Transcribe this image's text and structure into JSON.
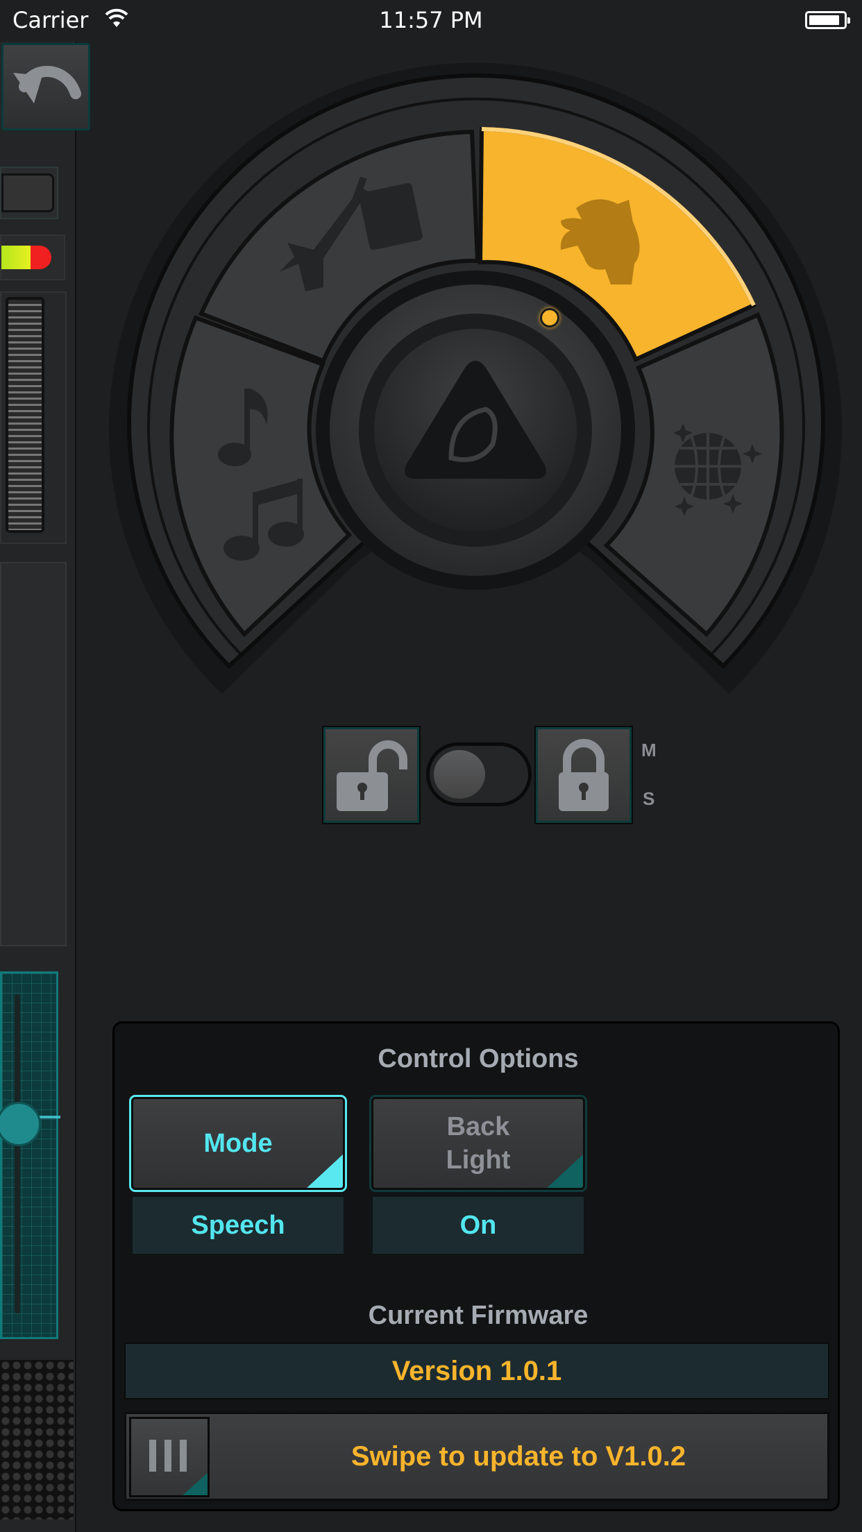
{
  "status_bar": {
    "carrier": "Carrier",
    "time": "11:57 PM"
  },
  "mode_selector": {
    "segments": [
      {
        "name": "guitar-amp",
        "icon": "guitar-amp-icon",
        "active": false
      },
      {
        "name": "speech",
        "icon": "speech-head-icon",
        "active": true
      },
      {
        "name": "party",
        "icon": "disco-ball-icon",
        "active": false
      },
      {
        "name": "music",
        "icon": "music-notes-icon",
        "active": false
      }
    ],
    "center_logo": "behringer-logo-icon",
    "accent_color": "#f7b42c"
  },
  "lock_controls": {
    "toggle_on": false,
    "m_label": "M",
    "s_label": "S"
  },
  "control_options": {
    "title": "Control Options",
    "mode_label": "Mode",
    "mode_value": "Speech",
    "backlight_label_line1": "Back",
    "backlight_label_line2": "Light",
    "backlight_value": "On",
    "firmware_title": "Current Firmware",
    "firmware_version": "Version 1.0.1",
    "swipe_label": "Swipe to update to V1.0.2"
  },
  "colors": {
    "cyan": "#53e6ef",
    "orange": "#f7b42c",
    "panel": "#121314"
  }
}
